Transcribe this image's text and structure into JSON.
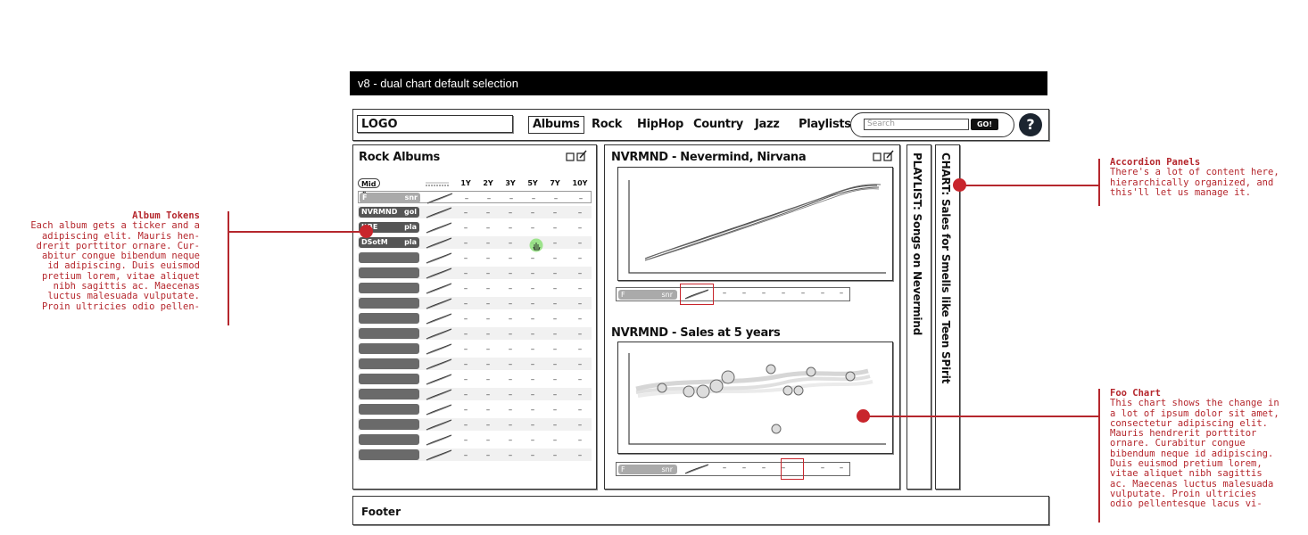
{
  "title_bar": "v8 - dual chart default selection",
  "nav": {
    "logo": "LOGO",
    "items": [
      "Albums",
      "Rock",
      "HipHop",
      "Country",
      "Jazz",
      "Playlists"
    ],
    "selected": "Albums",
    "search_placeholder": "Search",
    "go_label": "GO!",
    "help_label": "?"
  },
  "left_panel": {
    "title": "Rock Albums",
    "selector": "Mid",
    "columns": [
      "1Y",
      "2Y",
      "3Y",
      "5Y",
      "7Y",
      "10Y"
    ],
    "rows": [
      {
        "ticker": "F",
        "grade": "snr",
        "style": "light"
      },
      {
        "ticker": "NVRMND",
        "grade": "gol",
        "style": "dark"
      },
      {
        "ticker": "ItBE",
        "grade": "pla",
        "style": "dark"
      },
      {
        "ticker": "DSotM",
        "grade": "pla",
        "style": "dark"
      },
      {
        "ticker": "",
        "grade": "",
        "style": "dark"
      },
      {
        "ticker": "",
        "grade": "",
        "style": "dark"
      },
      {
        "ticker": "",
        "grade": "",
        "style": "dark"
      },
      {
        "ticker": "",
        "grade": "",
        "style": "dark"
      },
      {
        "ticker": "",
        "grade": "",
        "style": "dark"
      },
      {
        "ticker": "",
        "grade": "",
        "style": "dark"
      },
      {
        "ticker": "",
        "grade": "",
        "style": "dark"
      },
      {
        "ticker": "",
        "grade": "",
        "style": "dark"
      },
      {
        "ticker": "",
        "grade": "",
        "style": "dark"
      },
      {
        "ticker": "",
        "grade": "",
        "style": "dark"
      },
      {
        "ticker": "",
        "grade": "",
        "style": "dark"
      },
      {
        "ticker": "",
        "grade": "",
        "style": "dark"
      },
      {
        "ticker": "",
        "grade": "",
        "style": "dark"
      },
      {
        "ticker": "",
        "grade": "",
        "style": "dark"
      }
    ],
    "dash": "–"
  },
  "middle_panel": {
    "chart1_title": "NVRMND - Nevermind, Nirvana",
    "chart2_title": "NVRMND - Sales at 5 years",
    "strip_ticker": "F",
    "strip_grade": "snr"
  },
  "accordion": {
    "panel1": "PLAYLIST: Songs on Nevermind",
    "panel2": "CHART: Sales for Smells like Teen SPirit"
  },
  "footer": "Footer",
  "annotations": {
    "album_tokens": {
      "title": "Album Tokens",
      "lines": [
        "Each album gets a ticker and a",
        "adipiscing elit. Mauris hen-",
        "drerit porttitor ornare. Cur-",
        "abitur congue bibendum neque",
        "id adipiscing. Duis euismod",
        "pretium lorem, vitae aliquet",
        "nibh sagittis ac. Maecenas",
        "luctus malesuada vulputate.",
        "Proin ultricies odio pellen-"
      ]
    },
    "accordion_panels": {
      "title": "Accordion Panels",
      "lines": [
        "There's a lot of content here,",
        "hierarchically organized, and",
        "this'll let us manage it."
      ]
    },
    "foo_chart": {
      "title": "Foo Chart",
      "lines": [
        "This chart shows the change in",
        "a lot of ipsum dolor sit amet,",
        "consectetur adipiscing elit.",
        "Mauris hendrerit porttitor",
        "ornare. Curabitur congue",
        "bibendum neque id adipiscing.",
        "Duis euismod pretium lorem,",
        "vitae aliquet nibh sagittis",
        "ac. Maecenas luctus malesuada",
        "vulputate. Proin ultricies",
        "odio pellentesque lacus vi-"
      ]
    }
  },
  "colors": {
    "accent": "#c8252c",
    "ink": "#333333"
  }
}
